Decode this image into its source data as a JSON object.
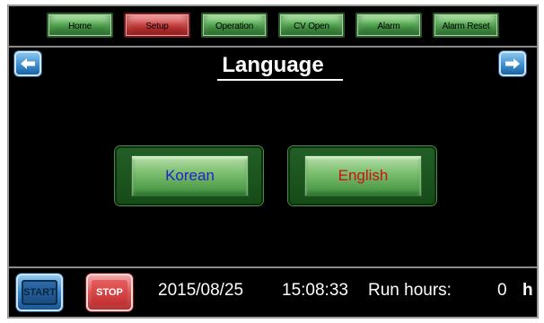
{
  "nav": {
    "home": "Home",
    "setup": "Setup",
    "operation": "Operation",
    "cv_open": "CV Open",
    "alarm": "Alarm",
    "alarm_reset": "Alarm Reset",
    "active": "setup"
  },
  "page": {
    "title": "Language",
    "prev_icon": "arrow-left-icon",
    "next_icon": "arrow-right-icon"
  },
  "languages": {
    "korean": "Korean",
    "english": "English",
    "korean_color": "#2222cc",
    "english_color": "#cc1111"
  },
  "footer": {
    "start_label": "START",
    "stop_label": "STOP",
    "date": "2015/08/25",
    "time": "15:08:33",
    "run_hours_label": "Run hours:",
    "run_hours_value": "0",
    "run_hours_unit": "h"
  },
  "colors": {
    "nav_green": "#4aa24a",
    "nav_active_red": "#c83c3c",
    "background": "#000000",
    "accent_blue": "#3c8fd0"
  }
}
